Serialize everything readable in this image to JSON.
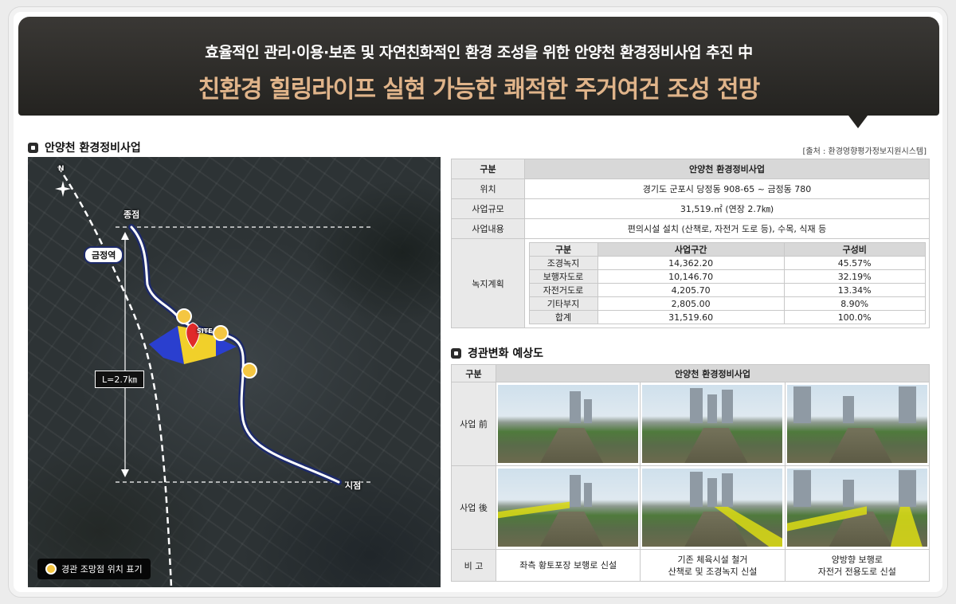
{
  "banner": {
    "line1": "효율적인 관리·이용·보존 및 자연친화적인 환경 조성을 위한 안양천 환경정비사업 추진 中",
    "line2": "친환경 힐링라이프 실현 가능한 쾌적한 주거여건 조성 전망"
  },
  "section1": {
    "title": "안양천 환경정비사업",
    "source": "[출처 : 환경영향평가정보지원시스템]"
  },
  "map": {
    "north": "N",
    "end_label": "종점",
    "start_label": "시점",
    "station": "금정역",
    "length": "L=2.7㎞",
    "site": "SITE",
    "legend": "경관 조망점 위치 표기"
  },
  "table1": {
    "header": {
      "col1": "구분",
      "col2": "안양천 환경정비사업"
    },
    "rows": [
      {
        "label": "위치",
        "value": "경기도 군포시 당정동 908-65 ~ 금정동 780"
      },
      {
        "label": "사업규모",
        "value": "31,519.㎡ (연장 2.7㎞)"
      },
      {
        "label": "사업내용",
        "value": "편의시설 설치 (산책로, 자전거 도로 등), 수목, 식재 등"
      }
    ],
    "green_label": "녹지계획",
    "green": {
      "headers": [
        "구분",
        "사업구간",
        "구성비"
      ],
      "rows": [
        [
          "조경녹지",
          "14,362.20",
          "45.57%"
        ],
        [
          "보행자도로",
          "10,146.70",
          "32.19%"
        ],
        [
          "자전거도로",
          "4,205.70",
          "13.34%"
        ],
        [
          "기타부지",
          "2,805.00",
          "8.90%"
        ],
        [
          "합계",
          "31,519.60",
          "100.0%"
        ]
      ]
    }
  },
  "section2": {
    "title": "경관변화 예상도"
  },
  "table2": {
    "header": {
      "col1": "구분",
      "col2": "안양천 환경정비사업"
    },
    "before_label": "사업 前",
    "after_label": "사업 後",
    "note_label": "비 고",
    "notes": [
      {
        "l1": "좌측 황토포장 보행로 신설",
        "l2": ""
      },
      {
        "l1": "기존 체육시설 철거",
        "l2": "산책로 및 조경녹지 신설"
      },
      {
        "l1": "양방향 보행로",
        "l2": "자전거 전용도로 신설"
      }
    ]
  },
  "colors": {
    "banner_bg": "#2b2a27",
    "banner_accent": "#e0b48a",
    "route": "#1d2a6a",
    "marker": "#f4c642"
  }
}
